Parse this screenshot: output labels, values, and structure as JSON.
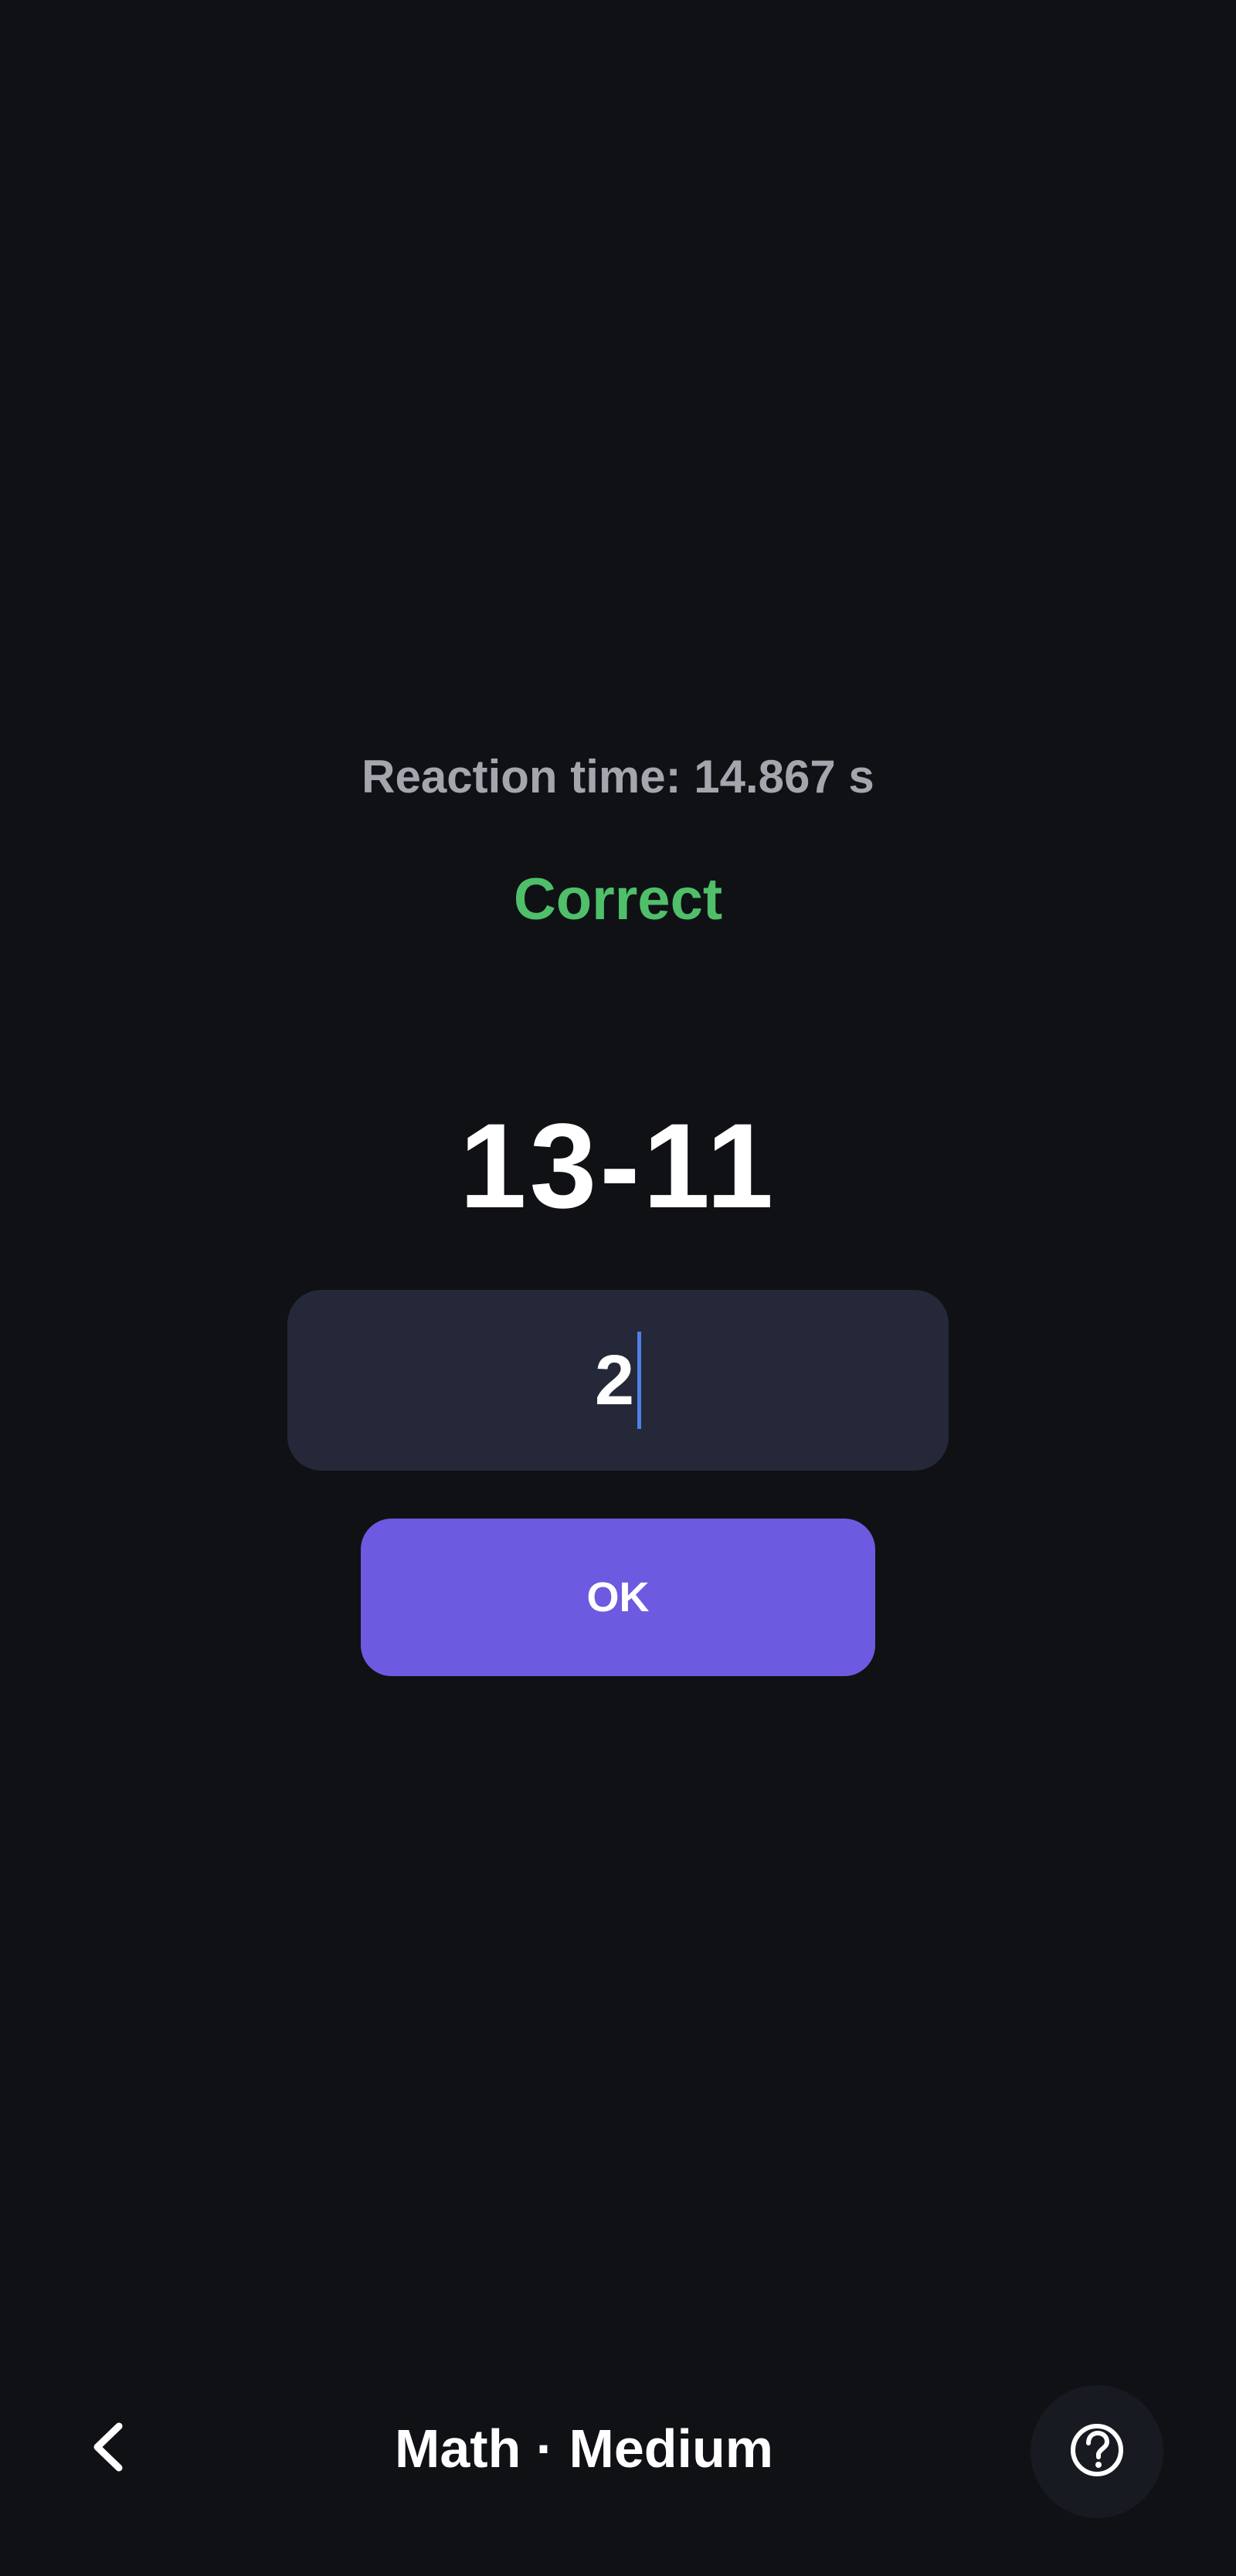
{
  "stats": {
    "reaction_time": "Reaction time: 14.867 s"
  },
  "feedback": {
    "result_text": "Correct",
    "result_color": "#4fbf6a"
  },
  "question": {
    "expression": "13-11"
  },
  "answer": {
    "value": "2"
  },
  "actions": {
    "ok_label": "OK"
  },
  "bottom_bar": {
    "back_icon": "chevron-left-icon",
    "title": "Math · Medium",
    "help_icon": "help-circle-icon"
  },
  "colors": {
    "background": "#0f1115",
    "input_background": "#242838",
    "accent": "#6c5be0",
    "caret": "#4e7fe8"
  }
}
